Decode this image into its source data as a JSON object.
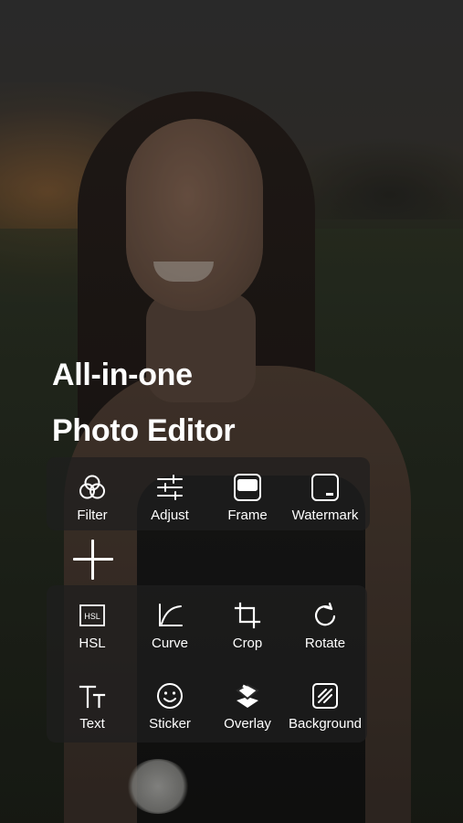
{
  "headline": {
    "line1": "All-in-one",
    "line2": "Photo Editor"
  },
  "tools_top": [
    {
      "label": "Filter",
      "icon": "filter-icon"
    },
    {
      "label": "Adjust",
      "icon": "adjust-icon"
    },
    {
      "label": "Frame",
      "icon": "frame-icon"
    },
    {
      "label": "Watermark",
      "icon": "watermark-icon"
    }
  ],
  "tools_bottom": [
    {
      "label": "HSL",
      "icon": "hsl-icon",
      "icon_text": "HSL"
    },
    {
      "label": "Curve",
      "icon": "curve-icon"
    },
    {
      "label": "Crop",
      "icon": "crop-icon"
    },
    {
      "label": "Rotate",
      "icon": "rotate-icon"
    },
    {
      "label": "Text",
      "icon": "text-icon"
    },
    {
      "label": "Sticker",
      "icon": "sticker-icon"
    },
    {
      "label": "Overlay",
      "icon": "overlay-icon"
    },
    {
      "label": "Background",
      "icon": "background-icon"
    }
  ],
  "colors": {
    "text": "#ffffff",
    "panel": "rgba(30,30,30,0.72)"
  }
}
